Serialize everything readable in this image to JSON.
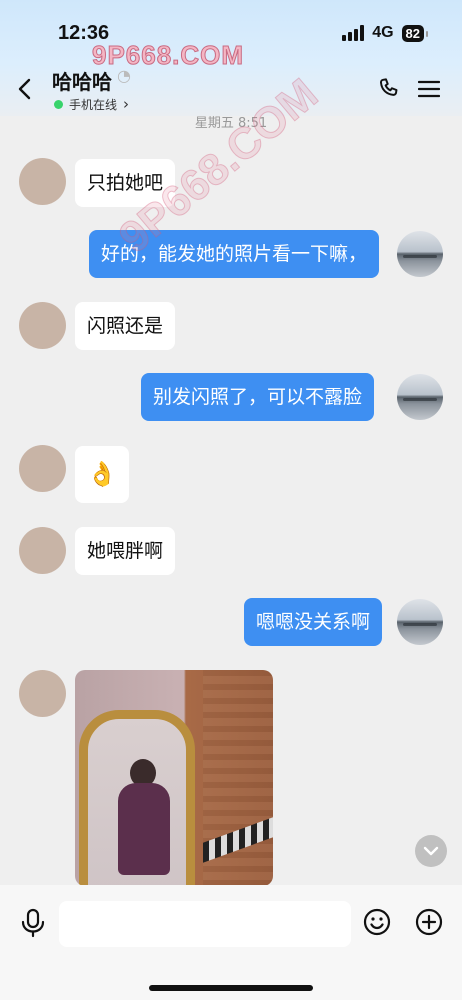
{
  "status_bar": {
    "time": "12:36",
    "network": "4G",
    "battery": "82"
  },
  "watermark": "9P668.COM",
  "watermark_diagonal": "9P668.COM",
  "header": {
    "contact_name": "哈哈哈",
    "online_status": "手机在线",
    "chevron": "›"
  },
  "timestamp": "星期五 8:51",
  "messages": [
    {
      "side": "left",
      "text": "只拍她吧"
    },
    {
      "side": "right",
      "text": "好的，能发她的照片看一下嘛，"
    },
    {
      "side": "left",
      "text": "闪照还是"
    },
    {
      "side": "right",
      "text": "别发闪照了，可以不露脸"
    },
    {
      "side": "left",
      "text": "👌"
    },
    {
      "side": "left",
      "text": "她喂胖啊"
    },
    {
      "side": "right",
      "text": "嗯嗯没关系啊"
    },
    {
      "side": "left",
      "type": "image"
    }
  ],
  "input": {
    "value": "",
    "placeholder": ""
  },
  "colors": {
    "accent": "#3e8ff2",
    "online": "#38d36b",
    "header_bg": "#cfe7fb"
  }
}
